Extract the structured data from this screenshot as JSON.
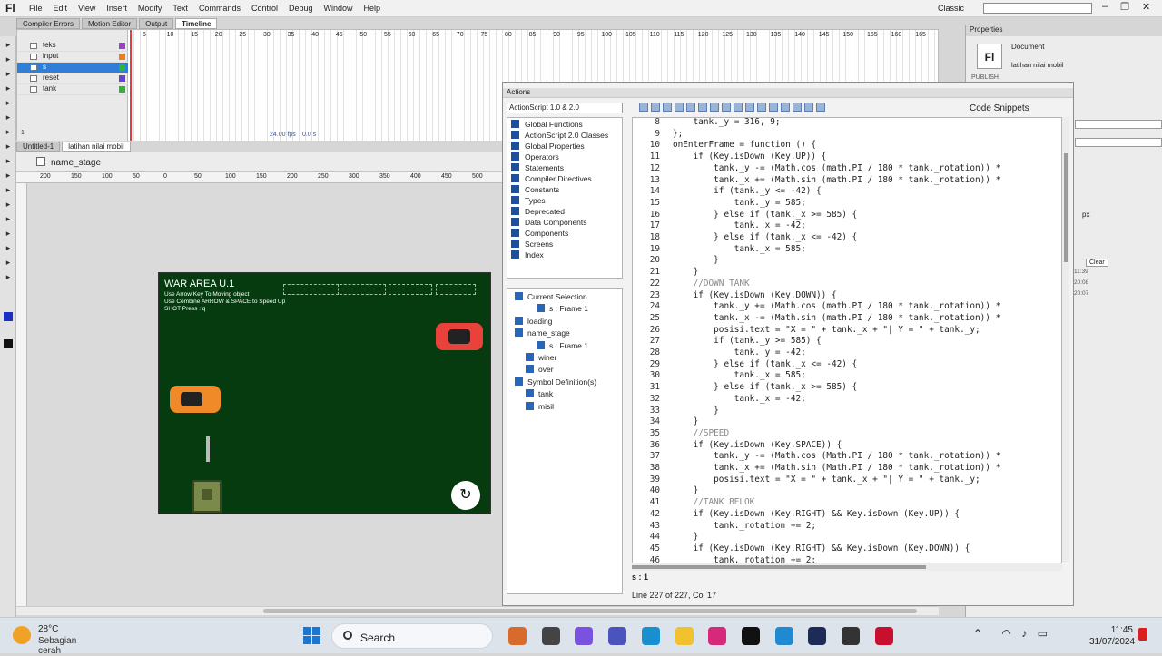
{
  "app": {
    "logo": "Fl",
    "workspace": "Classic"
  },
  "menu": [
    "File",
    "Edit",
    "View",
    "Insert",
    "Modify",
    "Text",
    "Commands",
    "Control",
    "Debug",
    "Window",
    "Help"
  ],
  "panel_tabs": [
    "Compiler Errors",
    "Motion Editor",
    "Output",
    "Timeline"
  ],
  "timeline": {
    "frame_numbers": [
      "5",
      "10",
      "15",
      "20",
      "25",
      "30",
      "35",
      "40",
      "45",
      "50",
      "55",
      "60",
      "65",
      "70",
      "75",
      "80",
      "85",
      "90",
      "95",
      "100",
      "105",
      "110",
      "115",
      "120",
      "125",
      "130",
      "135",
      "140",
      "145",
      "150",
      "155",
      "160",
      "165"
    ],
    "layers": [
      {
        "name": "teks",
        "color": "#9b3fd1"
      },
      {
        "name": "input",
        "color": "#f07d1a"
      },
      {
        "name": "s",
        "color": "#32b332",
        "selected": true
      },
      {
        "name": "reset",
        "color": "#6b3fd1"
      },
      {
        "name": "tank",
        "color": "#32b332"
      }
    ],
    "fps": "24.00 fps",
    "time": "0.0 s",
    "frame": "1"
  },
  "doc_tabs": [
    "Untitled-1",
    "latihan nilai mobil"
  ],
  "editbar": {
    "crumb": "name_stage"
  },
  "ruler": [
    "200",
    "150",
    "100",
    "50",
    "0",
    "50",
    "100",
    "150",
    "200",
    "250",
    "300",
    "350",
    "400",
    "450",
    "500"
  ],
  "stage": {
    "title": "WAR AREA U.1",
    "hints": [
      "Use Arrow Key To Moving object",
      "Use Combine ARROW & SPACE to Speed Up",
      "SHOT Press : q"
    ]
  },
  "actions": {
    "header": "Actions",
    "version": "ActionScript 1.0 & 2.0",
    "code_snippets": "Code Snippets",
    "library": [
      "Global Functions",
      "ActionScript 2.0 Classes",
      "Global Properties",
      "Operators",
      "Statements",
      "Compiler Directives",
      "Constants",
      "Types",
      "Deprecated",
      "Data Components",
      "Components",
      "Screens",
      "Index"
    ],
    "tree": [
      {
        "label": "Current Selection",
        "indent": 0
      },
      {
        "label": "s : Frame 1",
        "indent": 2
      },
      {
        "label": "loading",
        "indent": 0
      },
      {
        "label": "name_stage",
        "indent": 0
      },
      {
        "label": "s : Frame 1",
        "indent": 2
      },
      {
        "label": "winer",
        "indent": 1
      },
      {
        "label": "over",
        "indent": 1
      },
      {
        "label": "Symbol Definition(s)",
        "indent": 0
      },
      {
        "label": "tank",
        "indent": 1
      },
      {
        "label": "misil",
        "indent": 1
      }
    ],
    "code": [
      {
        "n": "8",
        "t": "    tank._y = 316, 9;"
      },
      {
        "n": "9",
        "t": "};"
      },
      {
        "n": "10",
        "t": "onEnterFrame = function () {"
      },
      {
        "n": "11",
        "t": "    if (Key.isDown (Key.UP)) {"
      },
      {
        "n": "12",
        "t": "        tank._y -= (Math.cos (math.PI / 180 * tank._rotation)) *"
      },
      {
        "n": "13",
        "t": "        tank._x += (Math.sin (math.PI / 180 * tank._rotation)) *"
      },
      {
        "n": "14",
        "t": "        if (tank._y <= -42) {"
      },
      {
        "n": "15",
        "t": "            tank._y = 585;"
      },
      {
        "n": "16",
        "t": "        } else if (tank._x >= 585) {"
      },
      {
        "n": "17",
        "t": "            tank._x = -42;"
      },
      {
        "n": "18",
        "t": "        } else if (tank._x <= -42) {"
      },
      {
        "n": "19",
        "t": "            tank._x = 585;"
      },
      {
        "n": "20",
        "t": "        }"
      },
      {
        "n": "21",
        "t": "    }"
      },
      {
        "n": "22",
        "t": "    //DOWN TANK"
      },
      {
        "n": "23",
        "t": "    if (Key.isDown (Key.DOWN)) {"
      },
      {
        "n": "24",
        "t": "        tank._y += (Math.cos (math.PI / 180 * tank._rotation)) *"
      },
      {
        "n": "25",
        "t": "        tank._x -= (Math.sin (math.PI / 180 * tank._rotation)) *"
      },
      {
        "n": "26",
        "t": "        posisi.text = \"X = \" + tank._x + \"| Y = \" + tank._y;"
      },
      {
        "n": "27",
        "t": "        if (tank._y >= 585) {"
      },
      {
        "n": "28",
        "t": "            tank._y = -42;"
      },
      {
        "n": "29",
        "t": "        } else if (tank._x <= -42) {"
      },
      {
        "n": "30",
        "t": "            tank._x = 585;"
      },
      {
        "n": "31",
        "t": "        } else if (tank._x >= 585) {"
      },
      {
        "n": "32",
        "t": "            tank._x = -42;"
      },
      {
        "n": "33",
        "t": "        }"
      },
      {
        "n": "34",
        "t": "    }"
      },
      {
        "n": "35",
        "t": "    //SPEED"
      },
      {
        "n": "36",
        "t": "    if (Key.isDown (Key.SPACE)) {"
      },
      {
        "n": "37",
        "t": "        tank._y -= (Math.cos (Math.PI / 180 * tank._rotation)) *"
      },
      {
        "n": "38",
        "t": "        tank._x += (Math.sin (Math.PI / 180 * tank._rotation)) *"
      },
      {
        "n": "39",
        "t": "        posisi.text = \"X = \" + tank._x + \"| Y = \" + tank._y;"
      },
      {
        "n": "40",
        "t": "    }"
      },
      {
        "n": "41",
        "t": "    //TANK BELOK"
      },
      {
        "n": "42",
        "t": "    if (Key.isDown (Key.RIGHT) && Key.isDown (Key.UP)) {"
      },
      {
        "n": "43",
        "t": "        tank._rotation += 2;"
      },
      {
        "n": "44",
        "t": "    }"
      },
      {
        "n": "45",
        "t": "    if (Key.isDown (Key.RIGHT) && Key.isDown (Key.DOWN)) {"
      },
      {
        "n": "46",
        "t": "        tank._rotation += 2;"
      }
    ],
    "script_tab": "s : 1",
    "status": "Line 227 of 227, Col 17"
  },
  "properties": {
    "header": "Properties",
    "doc_label": "Document",
    "file": "latihan nilai mobil",
    "logo": "Fl",
    "publish": "PUBLISH",
    "unit": "px",
    "clear": "Clear",
    "times": [
      "11:39",
      "20:08",
      "20:07"
    ]
  },
  "taskbar": {
    "temp": "28°C",
    "condition": "Sebagian cerah",
    "search": "Search",
    "time": "11:45",
    "date": "31/07/2024",
    "apps": [
      {
        "name": "food-icon",
        "color": "#d86a2c"
      },
      {
        "name": "folder-dark-icon",
        "color": "#444"
      },
      {
        "name": "copilot-icon",
        "color": "#7b52e0"
      },
      {
        "name": "teams-icon",
        "color": "#4b53bc"
      },
      {
        "name": "edge-icon",
        "color": "#1a8fcf"
      },
      {
        "name": "explorer-icon",
        "color": "#f2c12e"
      },
      {
        "name": "instagram-icon",
        "color": "#d6297a"
      },
      {
        "name": "tiktok-icon",
        "color": "#111"
      },
      {
        "name": "vscode-icon",
        "color": "#1f8ad2"
      },
      {
        "name": "animate-icon",
        "color": "#1e2a58"
      },
      {
        "name": "terminal-icon",
        "color": "#333"
      },
      {
        "name": "flash-icon",
        "color": "#c8102e"
      }
    ]
  }
}
